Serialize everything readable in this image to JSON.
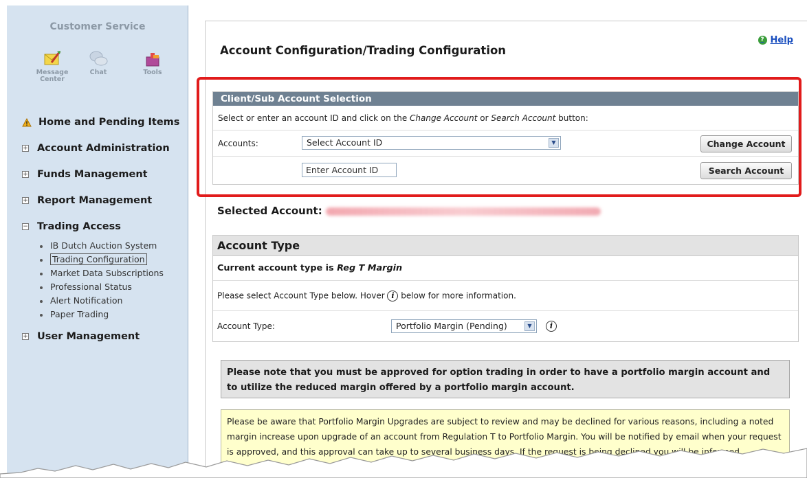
{
  "sidebar": {
    "title": "Customer Service",
    "tools": [
      {
        "label": "Message Center",
        "icon": "message-center-icon"
      },
      {
        "label": "Chat",
        "icon": "chat-icon"
      },
      {
        "label": "Tools",
        "icon": "tools-icon"
      }
    ],
    "nav": {
      "home": "Home and Pending Items",
      "account_admin": "Account Administration",
      "funds": "Funds Management",
      "report": "Report Management",
      "trading": "Trading Access",
      "user": "User Management"
    },
    "trading_items": [
      "IB Dutch Auction System",
      "Trading Configuration",
      "Market Data Subscriptions",
      "Professional Status",
      "Alert Notification",
      "Paper Trading"
    ],
    "expand_marker": "+",
    "collapse_marker": "−"
  },
  "main": {
    "title": "Account Configuration/Trading Configuration",
    "help": "Help",
    "client_section": {
      "header": "Client/Sub Account Selection",
      "instruction_prefix": "Select or enter an account ID and click on the ",
      "instruction_change": "Change Account",
      "instruction_or": " or ",
      "instruction_search": "Search Account",
      "instruction_suffix": " button:",
      "accounts_label": "Accounts:",
      "account_select": "Select Account ID",
      "change_button": "Change Account",
      "account_input_value": "Enter Account ID",
      "search_button": "Search Account"
    },
    "selected_account_label": "Selected Account:",
    "account_type": {
      "header": "Account Type",
      "current_prefix": "Current account type is ",
      "current_value": "Reg T Margin",
      "hover_prefix": "Please select Account Type below. Hover ",
      "hover_suffix": " below for more information.",
      "label": "Account Type:",
      "selected": "Portfolio Margin (Pending)"
    },
    "notice_gray": "Please note that you must be approved for option trading in order to have a portfolio margin account and to utilize the reduced margin offered by a portfolio margin account.",
    "notice_yellow": "Please be aware that Portfolio Margin Upgrades are subject to review and may be declined for various reasons, including a noted margin increase upon upgrade of an account from Regulation T to Portfolio Margin. You will be notified by email when your request is approved, and this approval can take up to several business days. If the request is being declined you will be informed"
  },
  "colors": {
    "sidebar_bg": "#d6e3f0",
    "section_header": "#6f8192",
    "highlight": "#e11b1b",
    "notice_yellow": "#ffffcc",
    "help_link": "#1a4fbf"
  }
}
